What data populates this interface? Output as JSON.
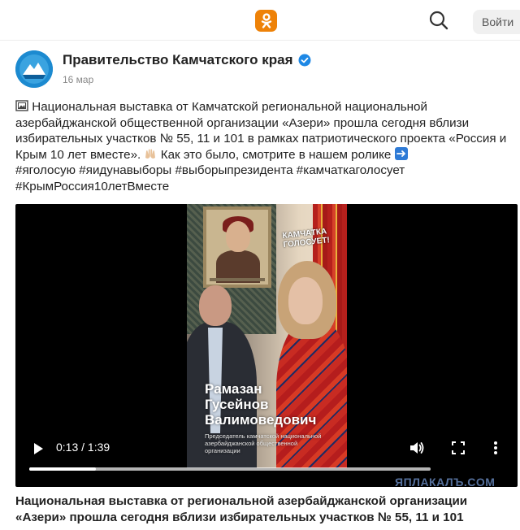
{
  "header": {
    "logo_icon": "odnoklassniki-icon",
    "logo_color": "#ee8208",
    "search_icon": "search-icon",
    "login_label": "Войти"
  },
  "post": {
    "author": "Правительство Камчатского края",
    "verified_icon": "verified-check-icon",
    "verified_color": "#1e88e5",
    "date": "16 мар",
    "text_main": "Национальная выставка от Камчатской региональной национальной азербайджанской общественной организации «Азери» прошла сегодня вблизи избирательных участков № 55, 11 и 101 в рамках патриотического проекта «Россия и Крым 10 лет вместе».",
    "text_more": "Как это было, смотрите в нашем ролике",
    "hashtags": [
      "#яголосую",
      "#яидунавыборы",
      "#выборыпрезидента",
      "#камчаткаголосует",
      "#КрымРоссия10летВместе"
    ]
  },
  "video": {
    "overlay_badge": "КАМЧАТКА ГОЛОСУЕТ!",
    "caption_name_line1": "Рамазан",
    "caption_name_line2": "Гусейнов",
    "caption_name_line3": "Валимоведович",
    "caption_role": "Председатель камчатской национальной азербайджанской общественной организации",
    "time_display": "0:13 / 1:39",
    "progress_fraction": 0.165,
    "buffered_fraction": 1.0,
    "play_icon": "play-icon",
    "volume_icon": "volume-icon",
    "fullscreen_icon": "fullscreen-icon",
    "more_icon": "more-vertical-icon"
  },
  "watermark": "ЯПЛАКАЛЪ.COM",
  "video_title": "Национальная выставка от региональной азербайджанской организации «Азери» прошла сегодня вблизи избирательных участков № 55, 11 и 101"
}
